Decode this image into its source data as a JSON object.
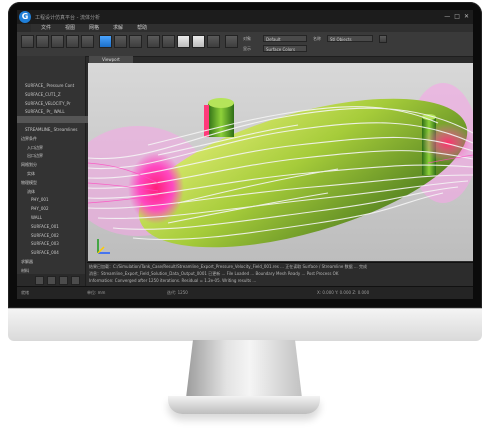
{
  "window": {
    "logo_letter": "G",
    "title": "工程设计仿真平台 - 流体分析",
    "controls": [
      "—",
      "□",
      "✕"
    ]
  },
  "menu": [
    "文件",
    "视图",
    "网格",
    "求解",
    "帮助"
  ],
  "toolbar": {
    "label1": "对象",
    "field1": "Default",
    "label2": "显示",
    "field2": "Surface Colors",
    "field3": "Stl Objects",
    "label3": "名称"
  },
  "tree": [
    "SURFACE_ Pressure Cont",
    "SURFACE_CUT1_Z",
    "SURFACE_VELOCITY_Pr",
    "SURFACE_ Pr_ WALL",
    "SURFACE_ Pr_ Pipe",
    "STREAMLINE_ Streamlines",
    "边界条件",
    "入口边界",
    "出口边界",
    "网格划分",
    "实体",
    "物理模型",
    "流体",
    "PHY_001",
    "PHY_002",
    "WALL",
    "SURFACE_001",
    "SURFACE_002",
    "SURFACE_003",
    "SURFACE_004",
    "求解器",
    "材料",
    "结果",
    "后处理"
  ],
  "view_tab": "Viewport",
  "console": [
    "结果已加载：C:/Simulation/Tank_Case/Result/Streamline_Export_Pressure_Velocity_Field_001.res ... 正在读取 Surface / Streamline 数据 ... 完成",
    "消息：Streamline_Export_Field_Solution_Data_Output_0001 已更新 ... File Loaded ... Boundary Mesh Ready ... Post Process OK",
    "Information: Converged after 1250 iterations. Residual = 1.2e-05. Writing results ..."
  ],
  "status": [
    "就绪",
    "单位: mm",
    "迭代: 1250",
    "X: 0.000  Y: 0.000  Z: 0.000"
  ],
  "colors": {
    "accent": "#1f7fd8",
    "vessel_green": "#9acd32",
    "hot_magenta": "#ff2ea6",
    "stream_white": "#f5f5f5"
  }
}
